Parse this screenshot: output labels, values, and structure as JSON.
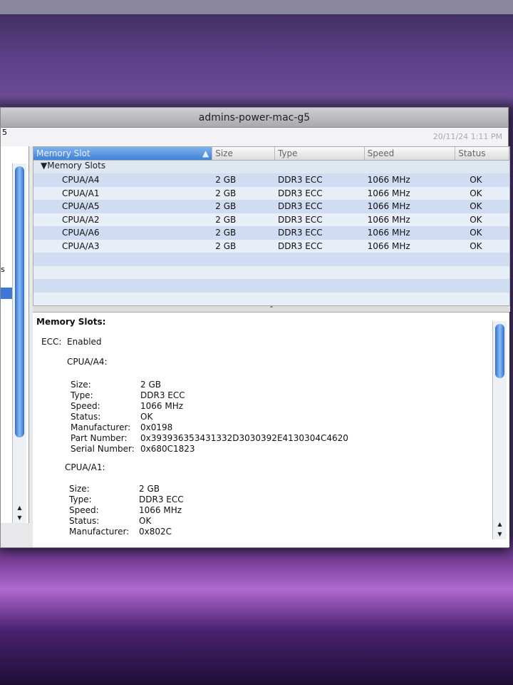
{
  "window": {
    "title": "admins-power-mac-g5",
    "left_fragment": "5",
    "sidebar_fragment": "s",
    "date": "20/11/24 1:11 PM"
  },
  "table": {
    "headers": [
      "Memory Slot",
      "Size",
      "Type",
      "Speed",
      "Status"
    ],
    "group": "Memory Slots",
    "rows": [
      [
        "CPUA/A4",
        "2 GB",
        "DDR3 ECC",
        "1066 MHz",
        "OK"
      ],
      [
        "CPUA/A1",
        "2 GB",
        "DDR3 ECC",
        "1066 MHz",
        "OK"
      ],
      [
        "CPUA/A5",
        "2 GB",
        "DDR3 ECC",
        "1066 MHz",
        "OK"
      ],
      [
        "CPUA/A2",
        "2 GB",
        "DDR3 ECC",
        "1066 MHz",
        "OK"
      ],
      [
        "CPUA/A6",
        "2 GB",
        "DDR3 ECC",
        "1066 MHz",
        "OK"
      ],
      [
        "CPUA/A3",
        "2 GB",
        "DDR3 ECC",
        "1066 MHz",
        "OK"
      ]
    ]
  },
  "detail": {
    "title": "Memory Slots:",
    "ecc_label": "ECC:",
    "ecc_value": "Enabled",
    "slot1": {
      "name": "CPUA/A4:",
      "labels": [
        "Size:",
        "Type:",
        "Speed:",
        "Status:",
        "Manufacturer:",
        "Part Number:",
        "Serial Number:"
      ],
      "values": [
        "2 GB",
        "DDR3 ECC",
        "1066 MHz",
        "OK",
        "0x0198",
        "0x393936353431332D3030392E4130304C4620",
        "0x680C1823"
      ]
    },
    "slot2": {
      "name": "CPUA/A1:",
      "labels": [
        "Size:",
        "Type:",
        "Speed:",
        "Status:",
        "Manufacturer:"
      ],
      "values": [
        "2 GB",
        "DDR3 ECC",
        "1066 MHz",
        "OK",
        "0x802C"
      ]
    }
  }
}
